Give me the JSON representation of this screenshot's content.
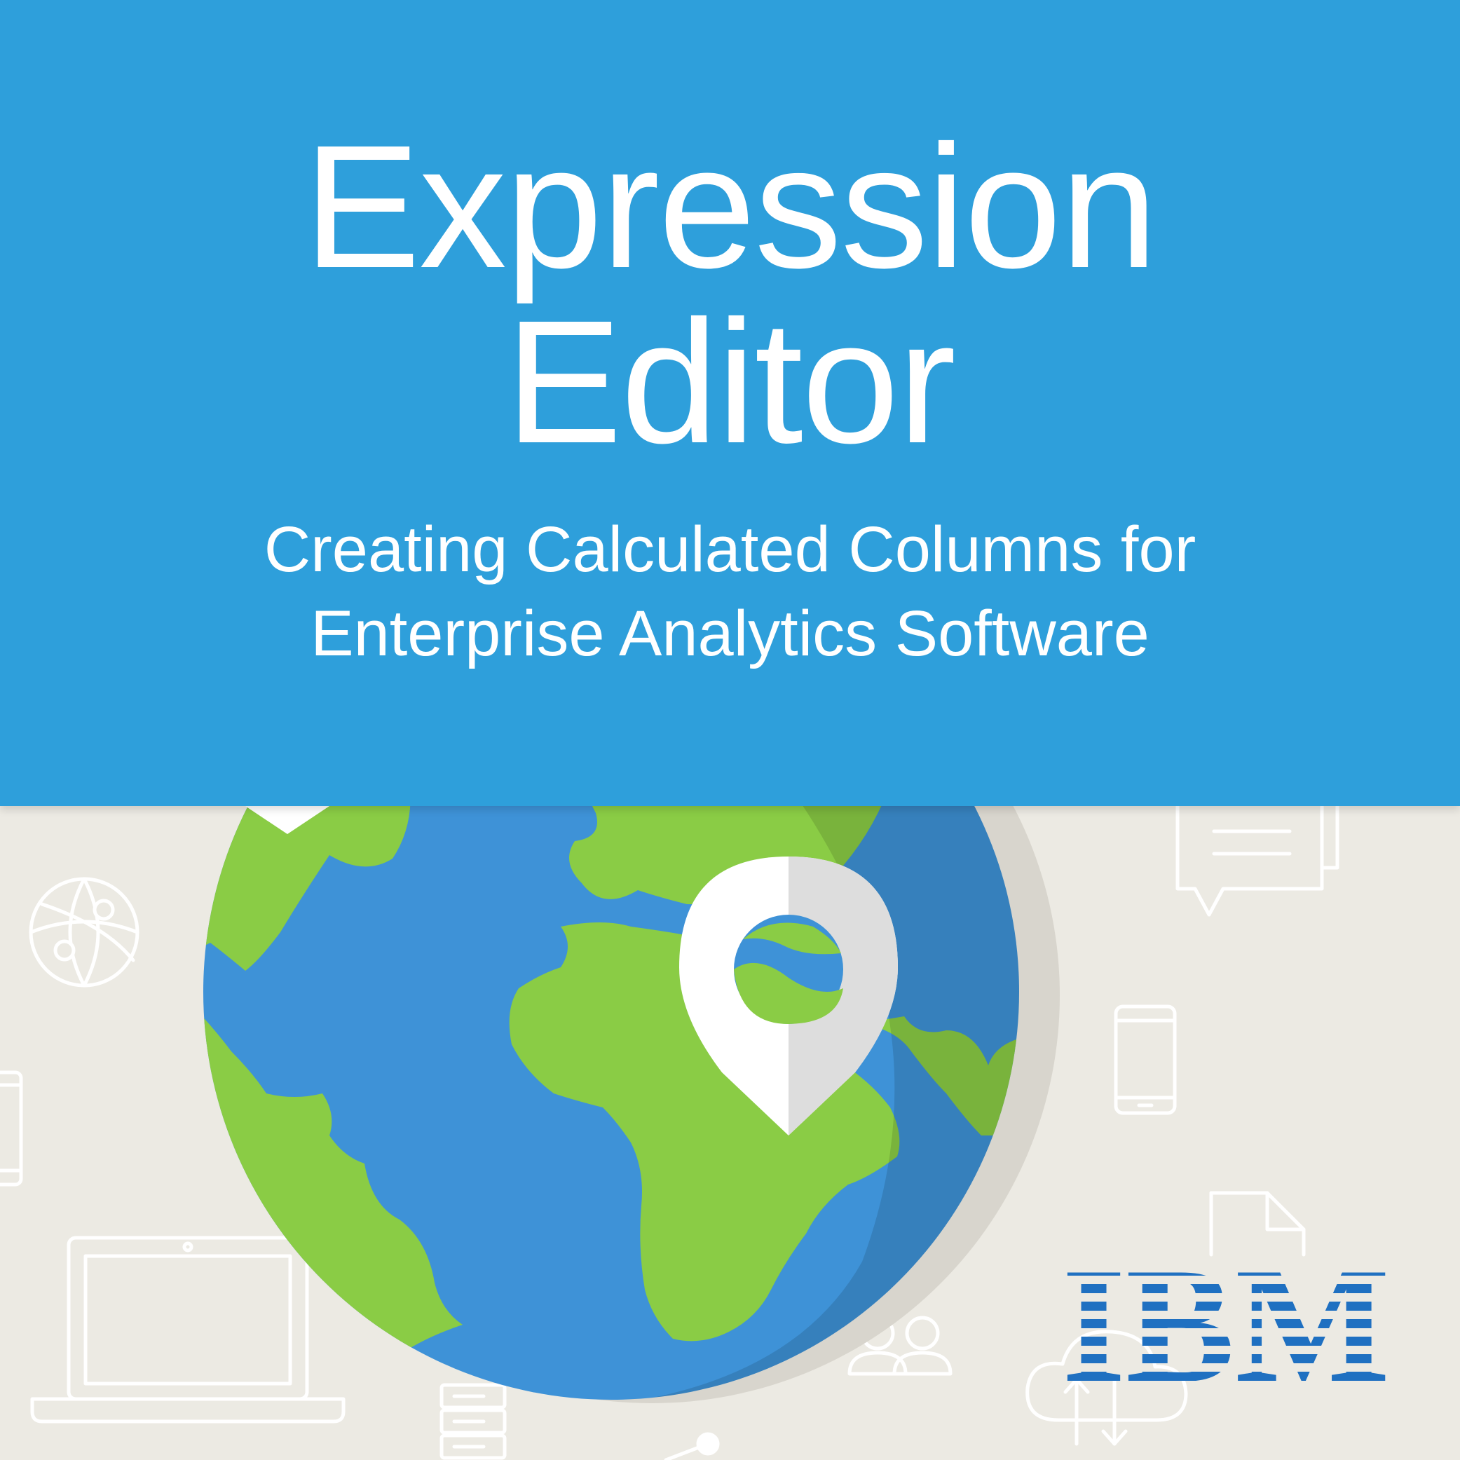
{
  "title": {
    "line1": "Expression",
    "line2": "Editor"
  },
  "subtitle": {
    "line1": "Creating Calculated Columns for",
    "line2": "Enterprise Analytics Software"
  },
  "logo": {
    "text": "IBM",
    "color": "#1F70C1"
  },
  "colors": {
    "header": "#2E9FDB",
    "background": "#ECEAE3",
    "ocean": "#3E92D7",
    "land": "#8ACC45"
  },
  "icons": [
    "globe-network-icon",
    "chat-bubble-icon",
    "smartphone-icon",
    "tablet-icon",
    "laptop-icon",
    "document-icon",
    "users-icon",
    "server-icon",
    "cloud-transfer-icon",
    "map-pin-icon"
  ]
}
